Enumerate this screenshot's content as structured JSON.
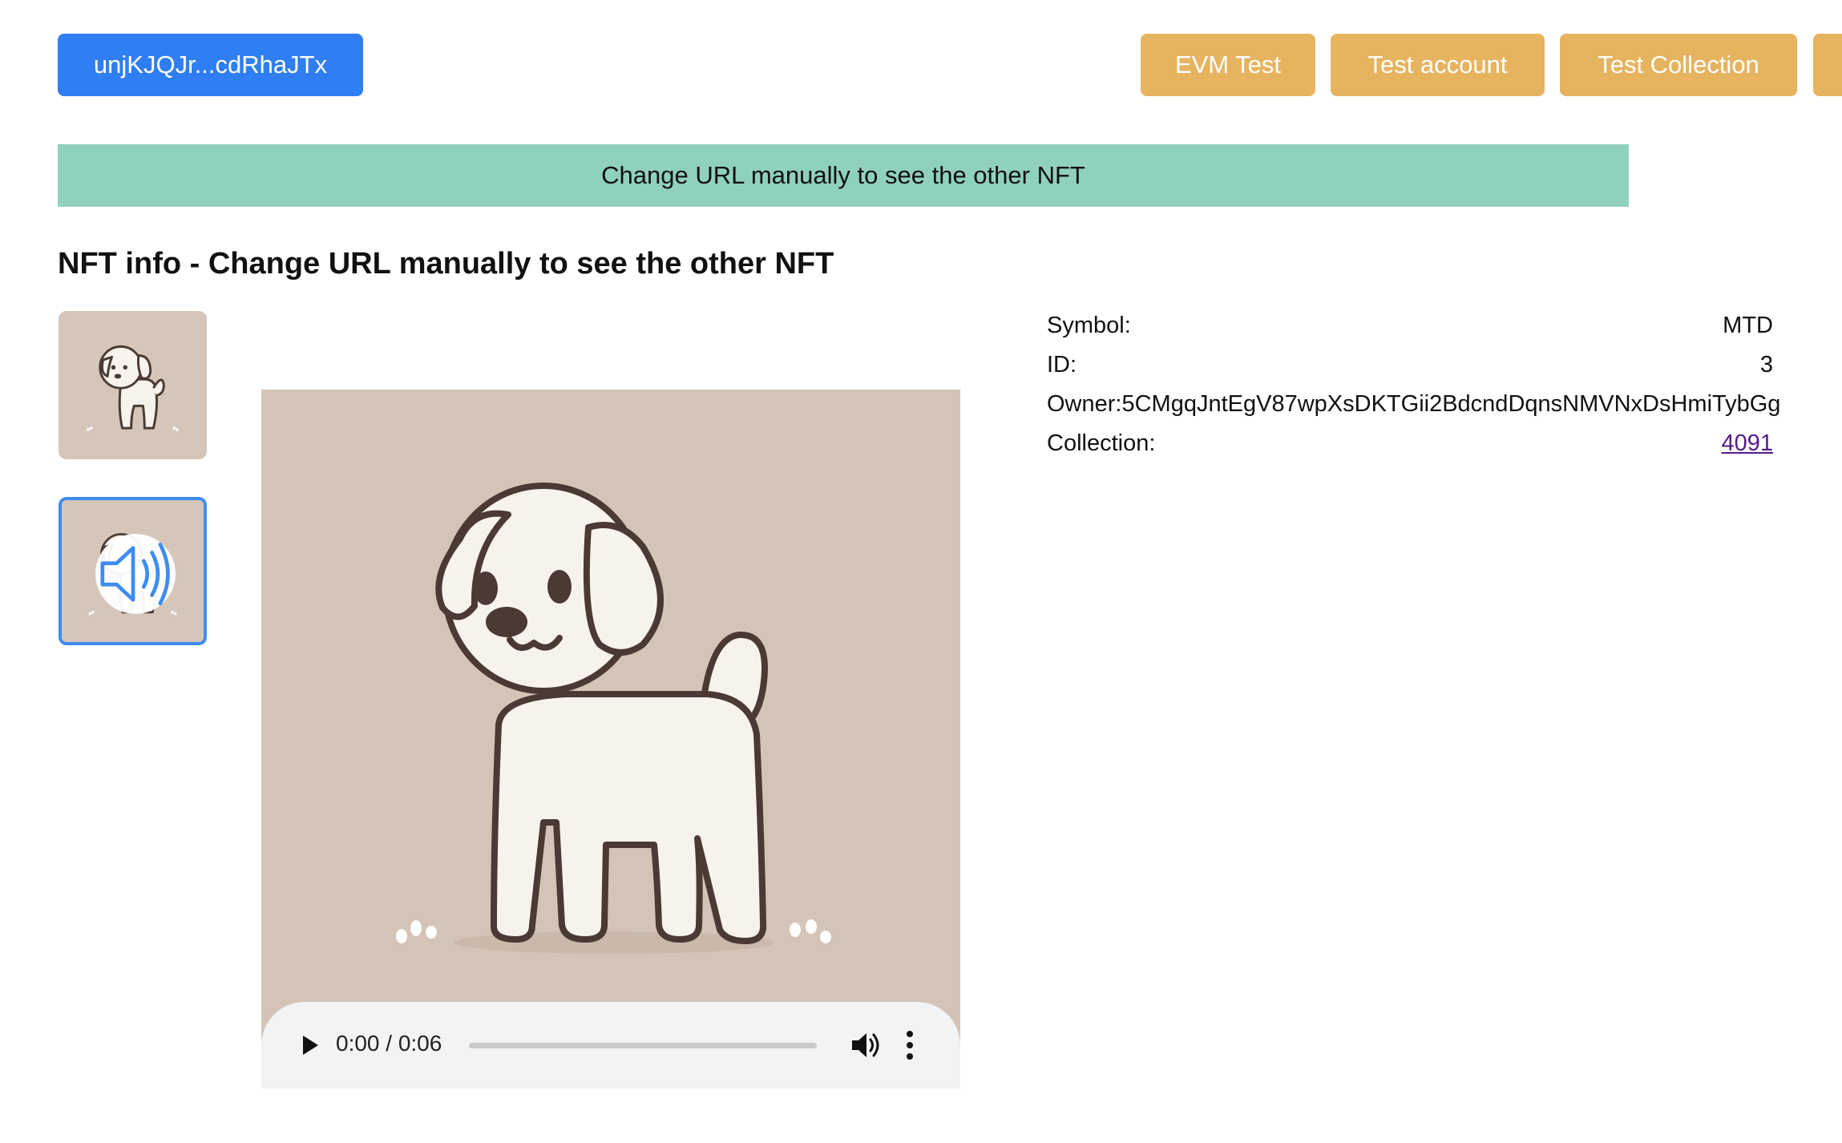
{
  "header": {
    "account_button": "unjKJQJr...cdRhaJTx",
    "nav_buttons": {
      "evm_test": "EVM Test",
      "test_account": "Test account",
      "test_collection": "Test Collection"
    }
  },
  "banner": {
    "text": "Change URL manually to see the other NFT"
  },
  "page": {
    "title": "NFT info - Change URL manually to see the other NFT"
  },
  "gallery": {
    "thumbnails": [
      {
        "kind": "image",
        "icon": "dog-thumbnail"
      },
      {
        "kind": "audio",
        "icon": "speaker-icon",
        "selected": true
      }
    ]
  },
  "player": {
    "time": "0:00 / 0:06",
    "progress": 0
  },
  "info": {
    "symbol_label": "Symbol:",
    "symbol_value": "MTD",
    "id_label": "ID:",
    "id_value": "3",
    "owner_label": "Owner:",
    "owner_value": "5CMgqJntEgV87wpXsDKTGii2BdcndDqnsNMVNxDsHmiTybGg",
    "collection_label": "Collection:",
    "collection_value": "4091"
  },
  "colors": {
    "primary": "#2f7ef3",
    "secondary": "#e6b35f",
    "banner": "#90d0bf",
    "link": "#551a8b",
    "selected_border": "#3d8cf0"
  }
}
